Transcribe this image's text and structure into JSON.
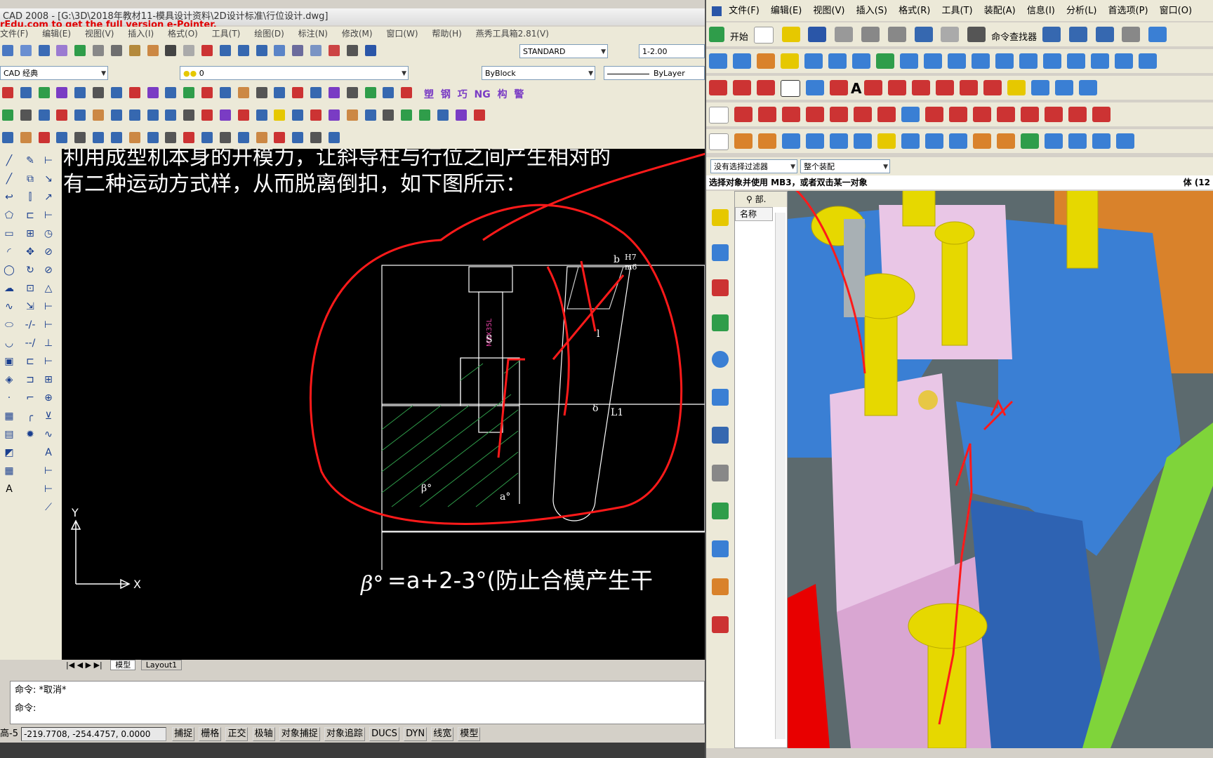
{
  "cad": {
    "title": "CAD 2008 - [G:\\3D\\2018年教材11-模具设计资料\\2D设计标准\\行位设计.dwg]",
    "watermark": "rEdu.com to get the full version e-Pointer.",
    "menu": [
      "文件(F)",
      "编辑(E)",
      "视图(V)",
      "插入(I)",
      "格式(O)",
      "工具(T)",
      "绘图(D)",
      "标注(N)",
      "修改(M)",
      "窗口(W)",
      "帮助(H)",
      "燕秀工具箱2.81(V)"
    ],
    "text_style": "STANDARD",
    "dim_scale": "1-2.00",
    "workspace": "CAD 经典",
    "layer": "0",
    "color": "ByBlock",
    "linetype": "ByLayer",
    "toolbar_chars": [
      "塑",
      "钢",
      "巧",
      "NG",
      "构",
      "警"
    ],
    "drawing": {
      "text_line1": "利用成型机本身的开模力，让斜导柱与行位之间产生相对的",
      "text_line2": "有二种运动方式样，从而脱离倒扣，如下图所示：",
      "formula": "=a+2-3°(防止合模产生干",
      "beta": "β°",
      "label_s": "S",
      "label_b": "b",
      "label_h7": "H7",
      "label_m6": "m6",
      "label_l": "l",
      "label_delta": "δ",
      "label_l1": "L1",
      "label_beta": "β°",
      "label_alpha": "a°",
      "bolt_text": "M8X35L",
      "axis_x": "X",
      "axis_y": "Y"
    },
    "tabs": {
      "model": "模型",
      "layout1": "Layout1"
    },
    "command_line1": "命令: *取消*",
    "command_line2": "命令:",
    "status": {
      "prefix": "高-5",
      "coord": "-219.7708, -254.4757, 0.0000",
      "buttons": [
        "捕捉",
        "栅格",
        "正交",
        "极轴",
        "对象捕捉",
        "对象追踪",
        "DUCS",
        "DYN",
        "线宽",
        "模型"
      ]
    }
  },
  "ug": {
    "menu": [
      "文件(F)",
      "编辑(E)",
      "视图(V)",
      "插入(S)",
      "格式(R)",
      "工具(T)",
      "装配(A)",
      "信息(I)",
      "分析(L)",
      "首选项(P)",
      "窗口(O)"
    ],
    "start_label": "开始",
    "cmd_finder": "命令查找器",
    "filter1": "没有选择过滤器",
    "filter2": "整个装配",
    "prompt": "选择对象并使用 MB3，或者双击某一对象",
    "prompt_right": "体 (12",
    "nav_title": "部.",
    "nav_header": "名称",
    "colors": {
      "pink": "#e9c6e6",
      "blue": "#3a7fd4",
      "yellow": "#e6d800",
      "green": "#7fd43a",
      "red": "#e80000",
      "orange": "#d9822b"
    }
  }
}
